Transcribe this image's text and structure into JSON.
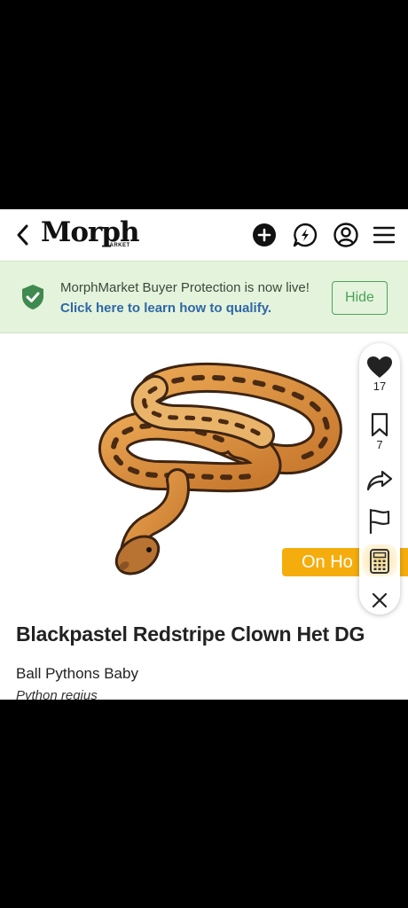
{
  "header": {
    "logo_text": "Morph",
    "logo_sub": "MARKET",
    "icons": [
      "chevron-left-icon",
      "plus-circle-icon",
      "chat-bolt-icon",
      "user-circle-icon",
      "menu-icon"
    ]
  },
  "banner": {
    "text": "MorphMarket Buyer Protection is now live! ",
    "link": "Click here to learn how to qualify.",
    "hide_label": "Hide",
    "icon": "shield-check-icon"
  },
  "listing": {
    "status_badge": "On Ho",
    "title": "Blackpastel Redstripe Clown Het DG",
    "category": "Ball Pythons Baby",
    "species": "Python regius"
  },
  "actions": {
    "like_count": "17",
    "save_count": "7",
    "icons": [
      "heart-icon",
      "bookmark-icon",
      "share-icon",
      "flag-icon",
      "calculator-icon",
      "close-icon"
    ]
  },
  "colors": {
    "banner_bg": "#e4f3dc",
    "accent_green": "#4aa35a",
    "link_blue": "#2f67a6",
    "on_hold": "#f5ad0d"
  }
}
